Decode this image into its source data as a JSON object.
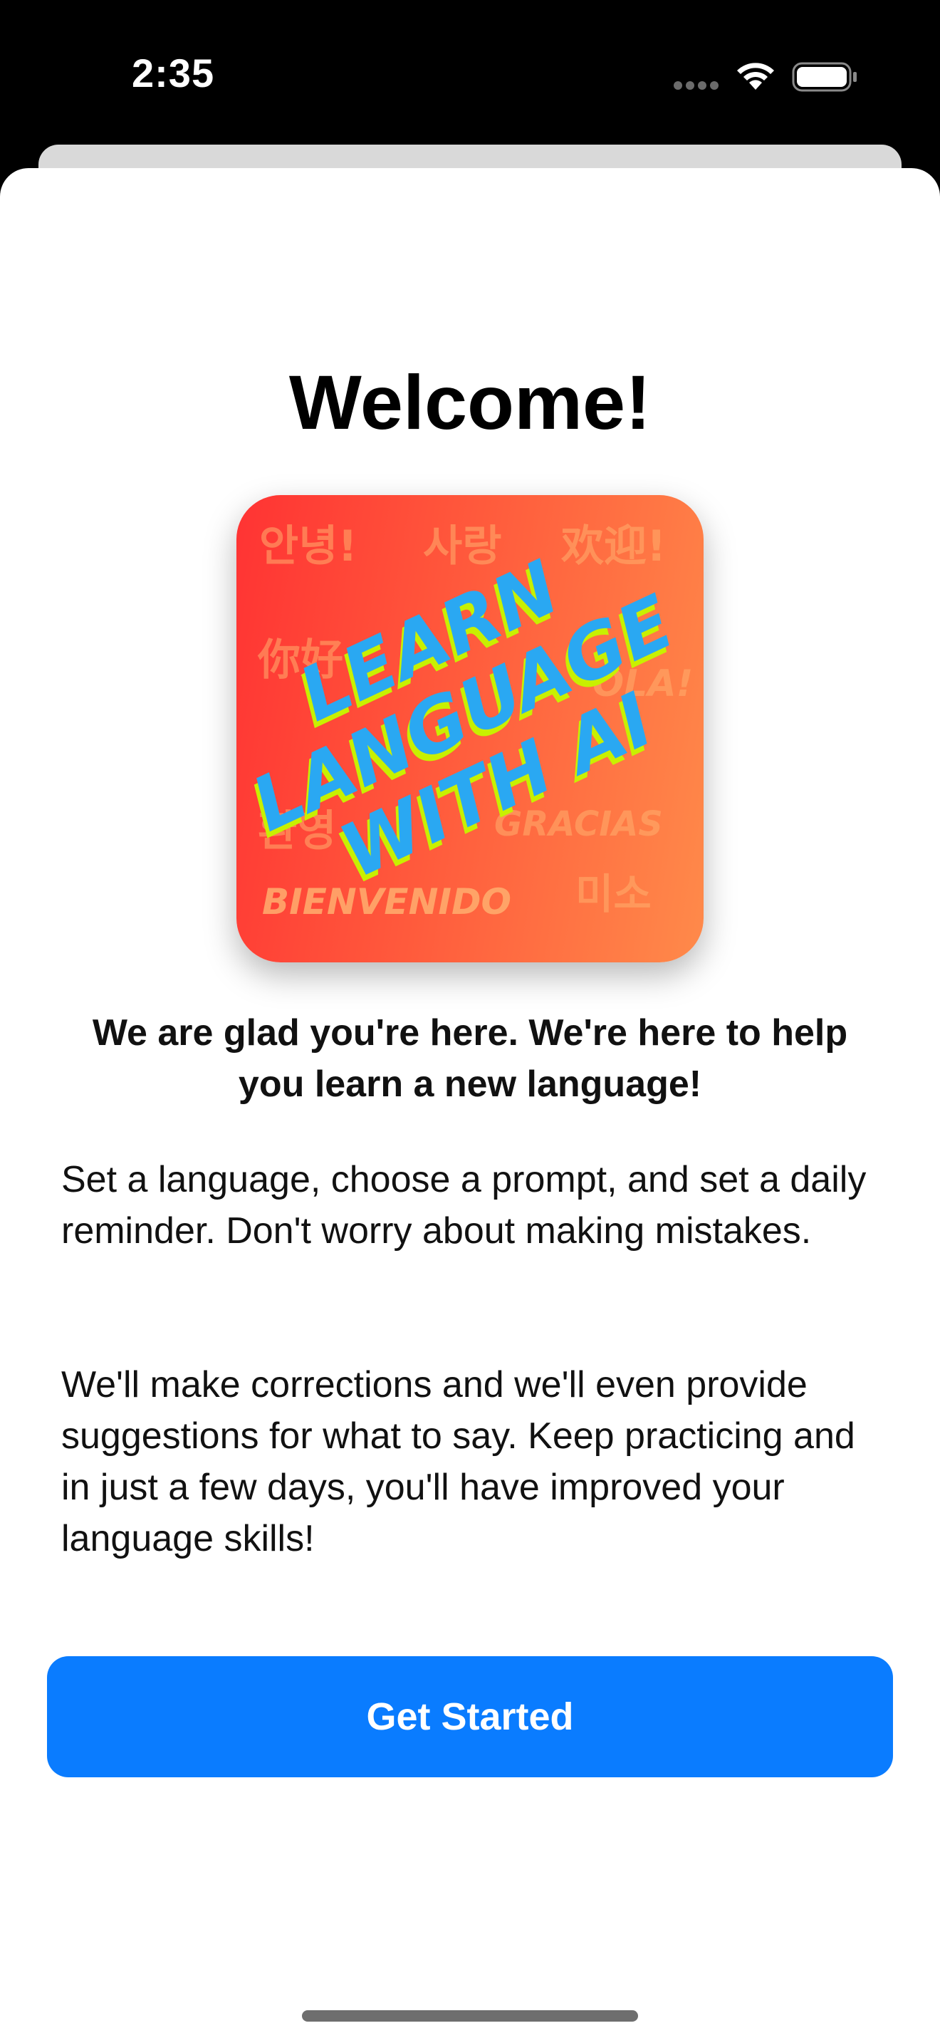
{
  "status_bar": {
    "time": "2:35",
    "icons": [
      "signal-dots-icon",
      "wifi-icon",
      "battery-icon"
    ]
  },
  "welcome": {
    "title": "Welcome!",
    "tagline": "We are glad you're here. We're here to help you learn a new language!",
    "paragraph_1": "Set a language, choose a prompt, and set a daily reminder. Don't worry about making mistakes.",
    "paragraph_2": "We'll make corrections and we'll even provide suggestions for what to say. Keep practicing and in just a few days, you'll have improved your language skills!"
  },
  "hero": {
    "headline_lines": [
      "LEARN",
      "LANGUAGE",
      "WITH AI"
    ],
    "background_words": [
      "안녕!",
      "사랑",
      "欢迎!",
      "你好",
      "OLA!",
      "환영",
      "GRACIAS",
      "BIENVENIDO",
      "미소"
    ],
    "colors": {
      "gradient_start": "#ff3333",
      "gradient_end": "#ff8a4a",
      "headline_fill": "#2aa8f2",
      "headline_shadow": "#c8f000"
    }
  },
  "actions": {
    "get_started_label": "Get Started"
  },
  "colors": {
    "accent": "#0a7cff",
    "background": "#ffffff",
    "status_bar": "#000000"
  }
}
